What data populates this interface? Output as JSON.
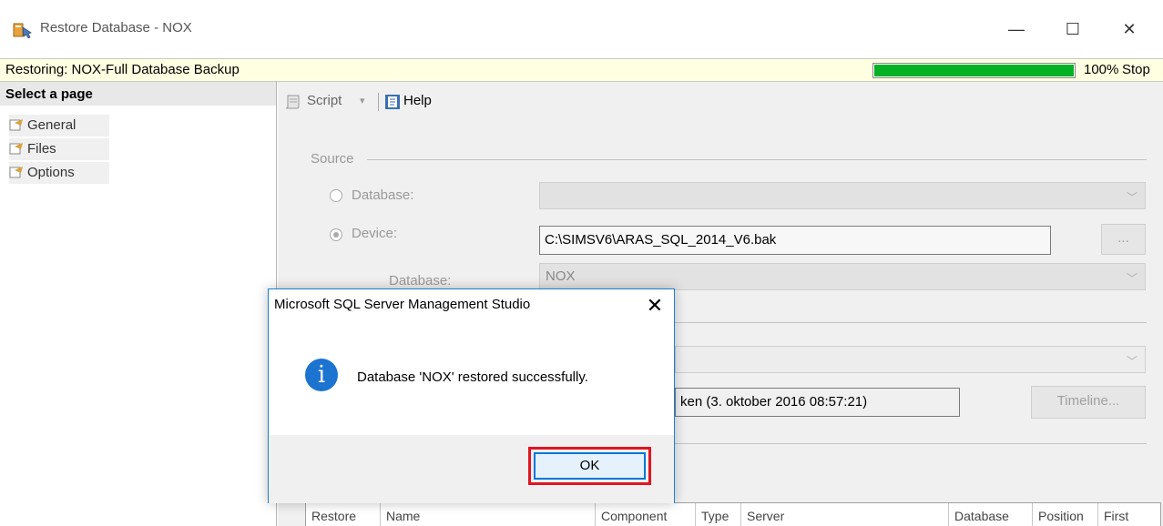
{
  "window": {
    "title": "Restore Database - NOX",
    "min_glyph": "—",
    "max_glyph": "☐",
    "close_glyph": "✕"
  },
  "status": {
    "text": "Restoring: NOX-Full Database Backup",
    "progress_percent": 100,
    "percent_label": "100%",
    "stop_label": "Stop",
    "progress_color": "#06b025"
  },
  "sidebar": {
    "header": "Select a page",
    "items": [
      {
        "label": "General"
      },
      {
        "label": "Files"
      },
      {
        "label": "Options"
      }
    ]
  },
  "toolbar": {
    "script_label": "Script",
    "dropdown_glyph": "▾",
    "help_label": "Help"
  },
  "source": {
    "group_label": "Source",
    "database_radio_label": "Database:",
    "device_radio_label": "Device:",
    "device_path": "C:\\SIMSV6\\ARAS_SQL_2014_V6.bak",
    "browse_label": "...",
    "sub_database_label": "Database:",
    "sub_database_value": "NOX"
  },
  "destination": {
    "restore_to_partial": "ken (3. oktober 2016 08:57:21)",
    "timeline_label": "Timeline..."
  },
  "backup_grid": {
    "columns": [
      "Restore",
      "Name",
      "Component",
      "Type",
      "Server",
      "Database",
      "Position",
      "First"
    ]
  },
  "dialog": {
    "title": "Microsoft SQL Server Management Studio",
    "close_glyph": "✕",
    "icon_glyph": "i",
    "message": "Database 'NOX' restored successfully.",
    "ok_label": "OK",
    "highlight_color": "#e11522",
    "accent_color": "#1c73d0"
  }
}
